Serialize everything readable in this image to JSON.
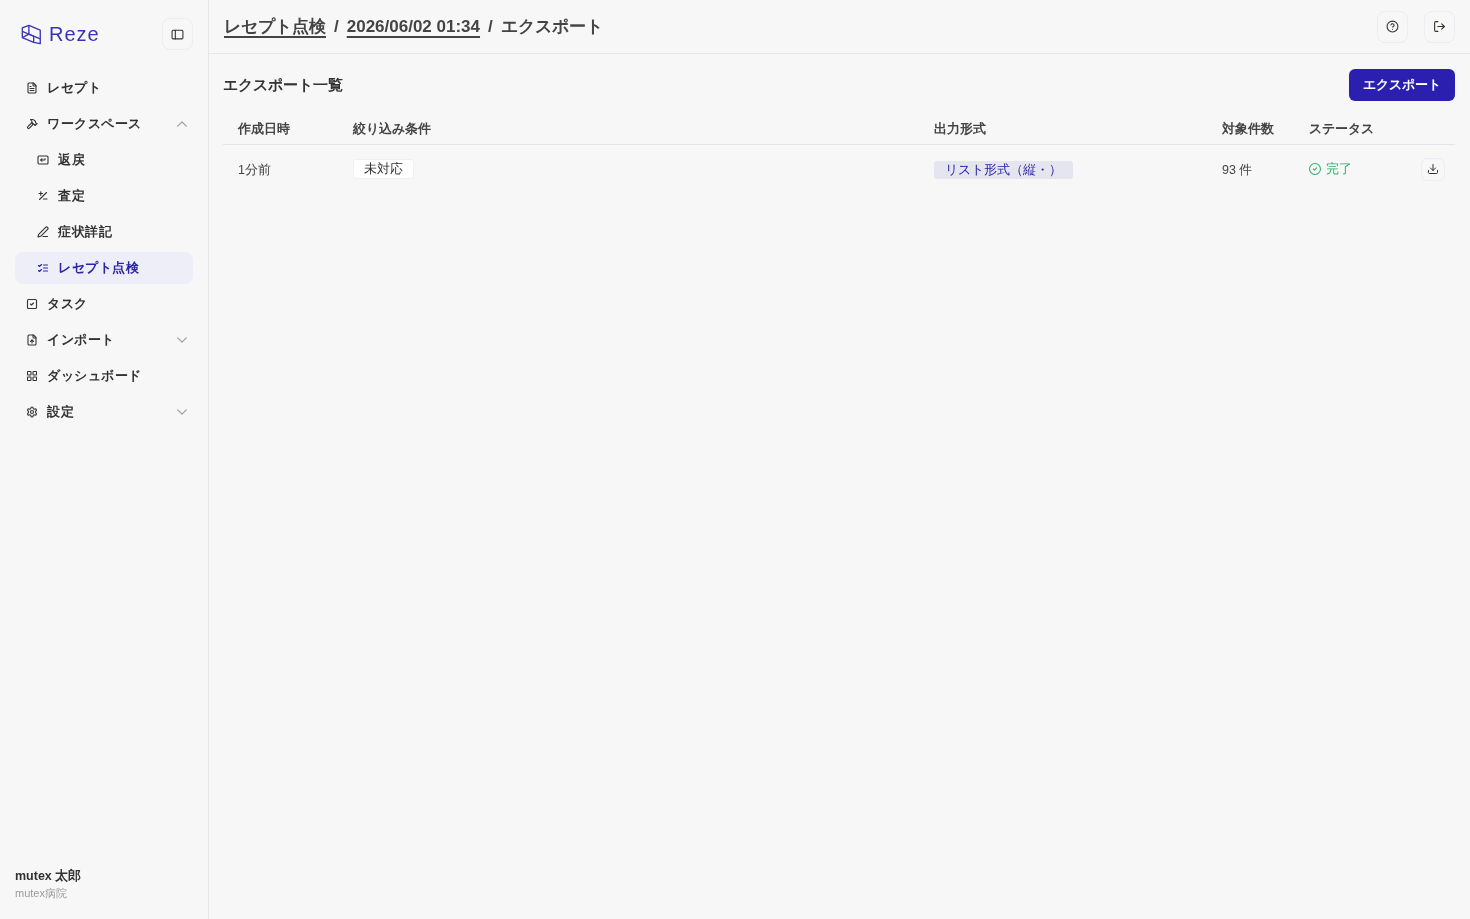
{
  "sidebar": {
    "logo": "Reze",
    "nav": [
      {
        "label": "レセプト",
        "selected": false
      },
      {
        "label": "ワークスペース",
        "selected": false,
        "expanded": true,
        "children": [
          {
            "label": "返戻",
            "selected": false
          },
          {
            "label": "査定",
            "selected": false
          },
          {
            "label": "症状詳記",
            "selected": false
          },
          {
            "label": "レセプト点検",
            "selected": true
          }
        ]
      },
      {
        "label": "タスク",
        "selected": false
      },
      {
        "label": "インポート",
        "selected": false,
        "expanded": false
      },
      {
        "label": "ダッシュボード",
        "selected": false
      },
      {
        "label": "設定",
        "selected": false,
        "expanded": false
      }
    ],
    "user": {
      "name": "mutex 太郎",
      "organization": "mutex病院"
    }
  },
  "header": {
    "breadcrumb": [
      {
        "kind": "link",
        "text": "レセプト点検"
      },
      {
        "kind": "separator",
        "text": "/"
      },
      {
        "kind": "link",
        "text": "2026/06/02 01:34"
      },
      {
        "kind": "separator",
        "text": "/"
      },
      {
        "kind": "current",
        "text": "エクスポート"
      }
    ]
  },
  "content": {
    "title": "エクスポート一覧",
    "export_button": "エクスポート",
    "table": {
      "columns": [
        "作成日時",
        "絞り込み条件",
        "出力形式",
        "対象件数",
        "ステータス"
      ],
      "rows": [
        {
          "created": "1分前",
          "filters": [
            "未対応"
          ],
          "format": "リスト形式（縦・）",
          "count": "93 件",
          "status": {
            "kind": "done",
            "text": "完了"
          }
        }
      ]
    }
  }
}
